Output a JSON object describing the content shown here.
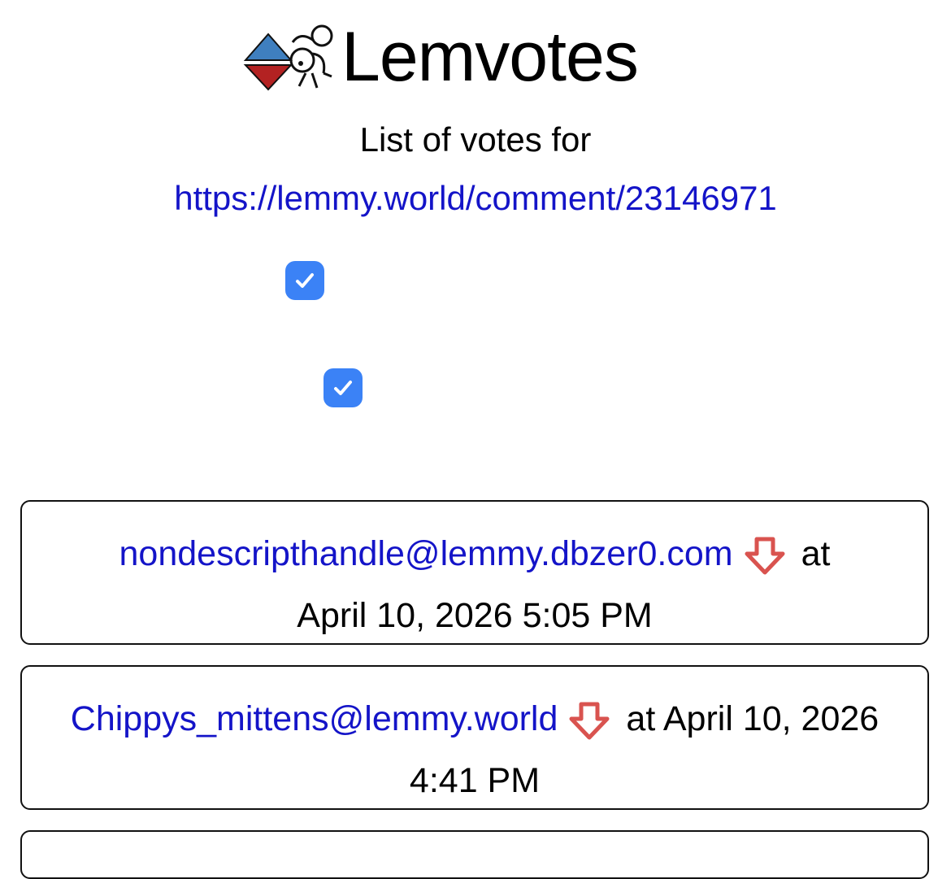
{
  "app": {
    "title": "Lemvotes",
    "subtitle": "List of votes for",
    "target_url": "https://lemmy.world/comment/23146971"
  },
  "filters": [
    {
      "name": "filter-checkbox-1",
      "checked": true
    },
    {
      "name": "filter-checkbox-2",
      "checked": true
    }
  ],
  "votes": [
    {
      "user": "nondescripthandle@lemmy.dbzer0.com",
      "direction_icon": "downvote-arrow-icon",
      "at_label": "at",
      "timestamp": "April 10, 2026 5:05 PM"
    },
    {
      "user": "Chippys_mittens@lemmy.world",
      "direction_icon": "downvote-arrow-icon",
      "at_label": "at",
      "timestamp": "April 10, 2026 4:41 PM"
    }
  ],
  "colors": {
    "link": "#1414c8",
    "checkbox": "#3b82f6",
    "downvote": "#d9534f",
    "logo_blue": "#3f7fbf",
    "logo_red": "#b32222"
  }
}
